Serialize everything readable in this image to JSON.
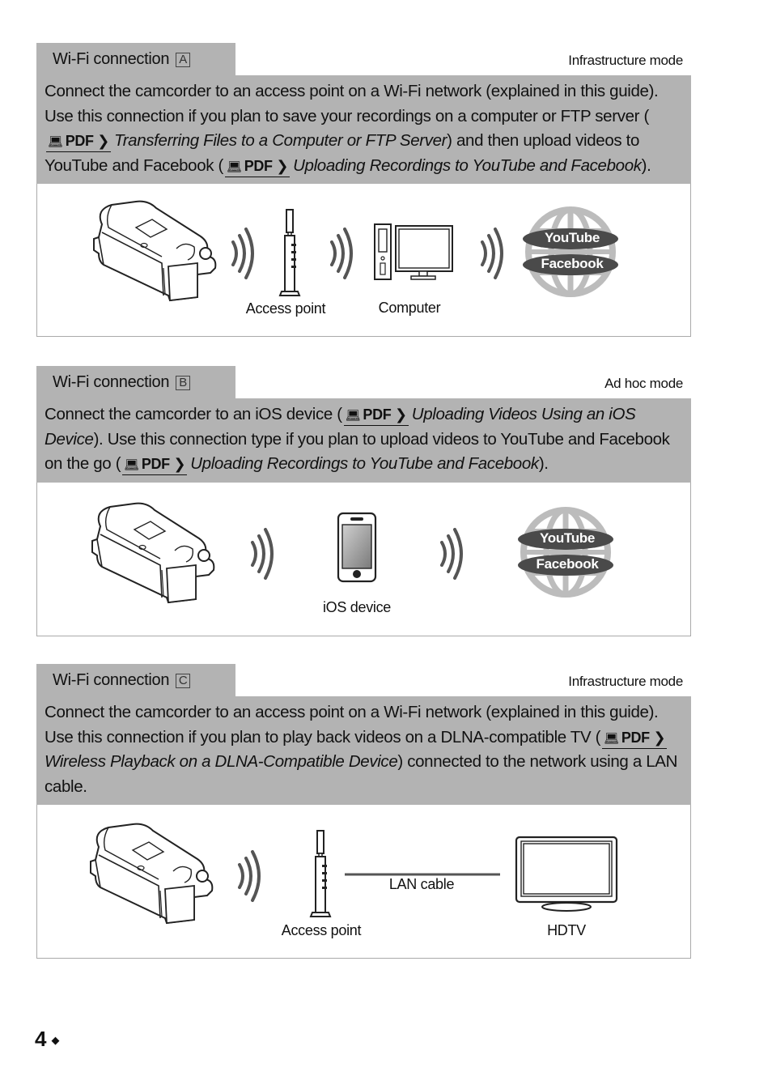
{
  "sections": [
    {
      "tab_title": "Wi-Fi connection",
      "tab_letter": "A",
      "mode": "Infrastructure mode",
      "desc": {
        "t1": "Connect the camcorder to an access point on a Wi-Fi network (explained in this guide). Use this connection if you plan to save your recordings on a computer or FTP server (",
        "ref1": "Transferring Files to a Computer or FTP Server",
        "t2": ") and then upload videos to YouTube and Facebook (",
        "ref2": "Uploading Recordings to YouTube and Facebook",
        "t3": ")."
      },
      "labels": {
        "access_point": "Access point",
        "computer": "Computer",
        "youtube": "YouTube",
        "facebook": "Facebook"
      }
    },
    {
      "tab_title": "Wi-Fi connection",
      "tab_letter": "B",
      "mode": "Ad hoc mode",
      "desc": {
        "t1": "Connect the camcorder to an iOS device (",
        "ref1": "Uploading Videos Using an iOS Device",
        "t2": "). Use this connection type if you plan to upload videos to YouTube and Facebook on the go (",
        "ref2": "Uploading Recordings to YouTube and Facebook",
        "t3": ")."
      },
      "labels": {
        "ios_device": "iOS device",
        "youtube": "YouTube",
        "facebook": "Facebook"
      }
    },
    {
      "tab_title": "Wi-Fi connection",
      "tab_letter": "C",
      "mode": "Infrastructure mode",
      "desc": {
        "t1": "Connect the camcorder to an access point on a Wi-Fi network (explained in this guide). Use this connection if you plan to play back videos on a DLNA-compatible TV (",
        "ref1": "Wireless Playback on a DLNA-Compatible Device",
        "t2": ") connected to the network using a LAN cable."
      },
      "labels": {
        "access_point": "Access point",
        "lan_cable": "LAN cable",
        "hdtv": "HDTV"
      }
    }
  ],
  "pdf_ref_label": "PDF",
  "pdf_ref_icon": "book-monitor-icon",
  "page_number": "4",
  "page_marker": "◆"
}
